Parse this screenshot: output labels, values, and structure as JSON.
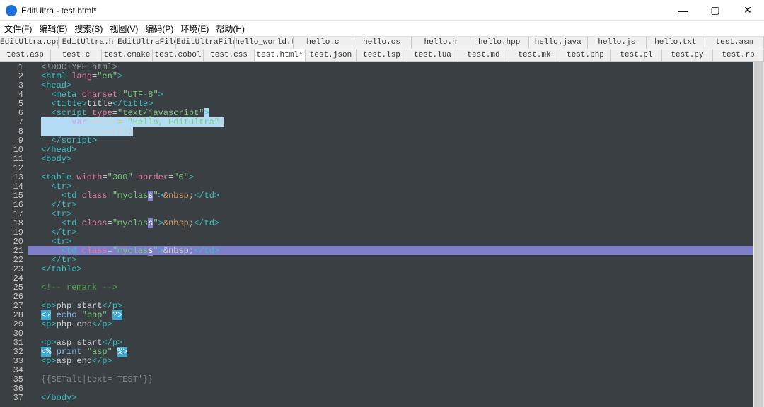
{
  "window": {
    "title": "EditUltra - test.html*",
    "btn_min": "—",
    "btn_max": "▢",
    "btn_close": "✕"
  },
  "menu": {
    "file": "文件(F)",
    "edit": "编辑(E)",
    "search": "搜索(S)",
    "view": "视图(V)",
    "encoding": "编码(P)",
    "env": "环境(E)",
    "help": "帮助(H)"
  },
  "tabs_row1": [
    "EditUltra.cpp",
    "EditUltra.h",
    "EditUltraFile.cpp",
    "EditUltraFile.h",
    "hello_world.txt",
    "hello.c",
    "hello.cs",
    "hello.h",
    "hello.hpp",
    "hello.java",
    "hello.js",
    "hello.txt",
    "test.asm"
  ],
  "tabs_row2": [
    "test.asp",
    "test.c",
    "test.cmake",
    "test.cobol",
    "test.css",
    "test.html*",
    "test.json",
    "test.lsp",
    "test.lua",
    "test.md",
    "test.mk",
    "test.php",
    "test.pl",
    "test.py",
    "test.rb"
  ],
  "active_tab": "test.html*",
  "code": {
    "lines": [
      {
        "n": 1,
        "html": "<span class='c-gray'>&lt;!DOCTYPE html&gt;</span>"
      },
      {
        "n": 2,
        "html": "<span class='c-teal'>&lt;html</span> <span class='c-pink'>lang</span>=<span class='c-green'>\"en\"</span><span class='c-teal'>&gt;</span>"
      },
      {
        "n": 3,
        "html": "<span class='c-teal'>&lt;head&gt;</span>"
      },
      {
        "n": 4,
        "html": "  <span class='c-teal'>&lt;meta</span> <span class='c-pink'>charset</span>=<span class='c-green'>\"UTF-8\"</span><span class='c-teal'>&gt;</span>"
      },
      {
        "n": 5,
        "html": "  <span class='c-teal'>&lt;title&gt;</span>title<span class='c-teal'>&lt;/title&gt;</span>"
      },
      {
        "n": 6,
        "html": "  <span class='c-teal'>&lt;script</span> <span class='c-pink'>type</span>=<span class='c-green'>\"text/javascript\"</span><span class='sel-block c-teal'>&gt;</span>"
      },
      {
        "n": 7,
        "html": "<span class='sel-block'>      <span class='c-keyw'>var</span> word <span class='c-yellow'>=</span> <span class='c-green'>\"Hello, EditUltra\"</span><span class='c-yellow'>;</span></span>"
      },
      {
        "n": 8,
        "html": "<span class='sel-block'>      alert(word)<span class='c-yellow'>;</span></span>"
      },
      {
        "n": 9,
        "html": "  <span class='c-teal'>&lt;/script&gt;</span>"
      },
      {
        "n": 10,
        "html": "<span class='c-teal'>&lt;/head&gt;</span>"
      },
      {
        "n": 11,
        "html": "<span class='c-teal'>&lt;body&gt;</span>"
      },
      {
        "n": 12,
        "html": ""
      },
      {
        "n": 13,
        "html": "<span class='c-teal'>&lt;table</span> <span class='c-pink'>width</span>=<span class='c-green'>\"300\"</span> <span class='c-pink'>border</span>=<span class='c-green'>\"0\"</span><span class='c-teal'>&gt;</span>"
      },
      {
        "n": 14,
        "html": "  <span class='c-teal'>&lt;tr&gt;</span>"
      },
      {
        "n": 15,
        "html": "    <span class='c-teal'>&lt;td</span> <span class='c-pink'>class</span>=<span class='c-green'>\"myclas<span class='cursor-mark'>s</span>\"</span><span class='c-teal'>&gt;</span><span class='c-orange'>&amp;nbsp;</span><span class='c-teal'>&lt;/td&gt;</span>"
      },
      {
        "n": 16,
        "html": "  <span class='c-teal'>&lt;/tr&gt;</span>"
      },
      {
        "n": 17,
        "html": "  <span class='c-teal'>&lt;tr&gt;</span>"
      },
      {
        "n": 18,
        "html": "    <span class='c-teal'>&lt;td</span> <span class='c-pink'>class</span>=<span class='c-green'>\"myclas<span class='cursor-mark'>s</span>\"</span><span class='c-teal'>&gt;</span><span class='c-orange'>&amp;nbsp;</span><span class='c-teal'>&lt;/td&gt;</span>"
      },
      {
        "n": 19,
        "html": "  <span class='c-teal'>&lt;/tr&gt;</span>"
      },
      {
        "n": 20,
        "html": "  <span class='c-teal'>&lt;tr&gt;</span>"
      },
      {
        "n": 21,
        "sel": true,
        "html": "    <span class='c-teal'>&lt;td</span> <span class='c-pink'>class</span>=<span class='c-green'>\"myclas<span class='cursor-mark'>s</span>\"</span><span class='c-teal'>&gt;</span>&amp;nbsp;<span class='c-teal'>&lt;/td&gt;</span>"
      },
      {
        "n": 22,
        "html": "  <span class='c-teal'>&lt;/tr&gt;</span>"
      },
      {
        "n": 23,
        "html": "<span class='c-teal'>&lt;/table&gt;</span>"
      },
      {
        "n": 24,
        "html": ""
      },
      {
        "n": 25,
        "html": "<span class='c-comment'>&lt;!-- remark --&gt;</span>"
      },
      {
        "n": 26,
        "html": ""
      },
      {
        "n": 27,
        "html": "<span class='c-teal'>&lt;p&gt;</span>php start<span class='c-teal'>&lt;/p&gt;</span>"
      },
      {
        "n": 28,
        "html": "<span class='sel-cyan'>&lt;?</span> <span class='c-lblue'>echo</span> <span class='c-green'>\"php\"</span> <span class='sel-cyan'>?&gt;</span>"
      },
      {
        "n": 29,
        "html": "<span class='c-teal'>&lt;p&gt;</span>php end<span class='c-teal'>&lt;/p&gt;</span>"
      },
      {
        "n": 30,
        "html": ""
      },
      {
        "n": 31,
        "html": "<span class='c-teal'>&lt;p&gt;</span>asp start<span class='c-teal'>&lt;/p&gt;</span>"
      },
      {
        "n": 32,
        "html": "<span class='sel-cyan'>&lt;%</span> <span class='c-lblue'>print</span> <span class='c-green'>\"asp\"</span> <span class='sel-cyan'>%&gt;</span>"
      },
      {
        "n": 33,
        "html": "<span class='c-teal'>&lt;p&gt;</span>asp end<span class='c-teal'>&lt;/p&gt;</span>"
      },
      {
        "n": 34,
        "html": ""
      },
      {
        "n": 35,
        "html": "<span class='c-dim'>{{SETalt|text='TEST'}}</span>"
      },
      {
        "n": 36,
        "html": ""
      },
      {
        "n": 37,
        "html": "<span class='c-teal'>&lt;/body&gt;</span>"
      }
    ]
  }
}
